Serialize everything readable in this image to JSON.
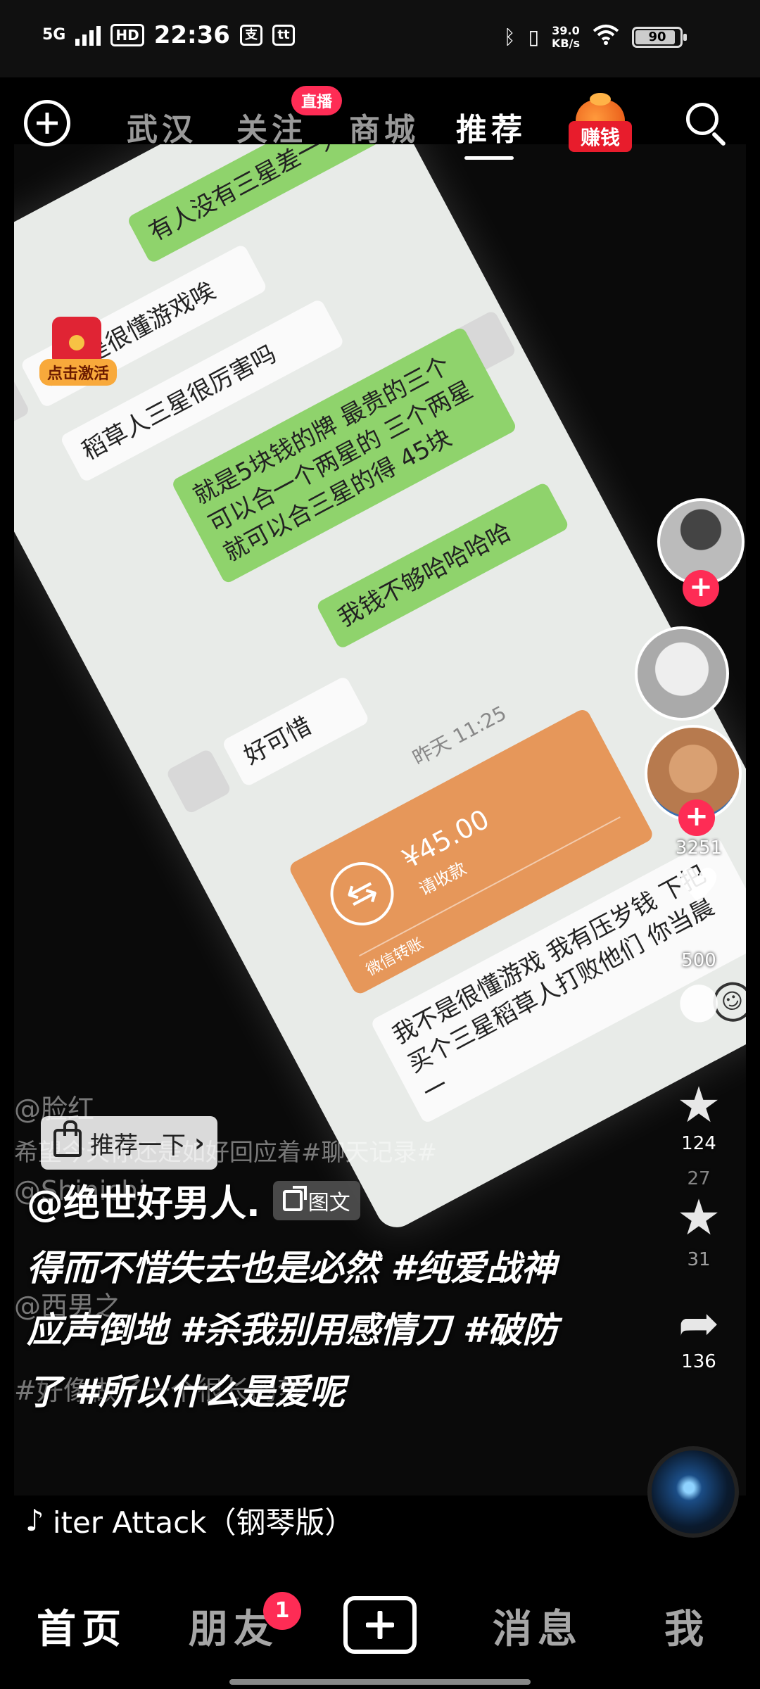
{
  "status_bar": {
    "network": "5G",
    "hd": "HD",
    "time": "22:36",
    "app_icon_1": "支",
    "app_icon_2": "tt",
    "speed_value": "39.0",
    "speed_unit": "KB/s",
    "battery": "90",
    "battery_level": 0.9
  },
  "top_nav": {
    "tabs": [
      "武汉",
      "关注",
      "商城",
      "推荐"
    ],
    "active_tab": "推荐",
    "live_badge": "直播",
    "earn_label": "赚钱"
  },
  "video": {
    "chat": {
      "b1": "有人没有三星差一只",
      "b2": "我不是很懂游戏唉",
      "b3": "稻草人三星很厉害吗",
      "b4": "就是5块钱的牌 最贵的三个可以合一个两星的 三个两星就可以合三星的得 45块",
      "b5": "我钱不够哈哈哈哈",
      "b6": "好可惜",
      "timestamp": "昨天 11:25",
      "transfer_amount": "¥45.00",
      "transfer_sub": "请收款",
      "transfer_note": "微信转账",
      "b7": "我不是很懂游戏 我有压岁钱 下把买个三星稻草人打败他们 你当晨一"
    },
    "ghost_lines": [
      "@脸红",
      "希望今天你还是如好回应着#聊天记录#",
      "@Shinichi",
      "@西男之",
      "#好像做了一个很长的梦"
    ]
  },
  "activate_widget": {
    "label": "点击激活"
  },
  "rail": {
    "likes": "3251",
    "comments": "500",
    "favorites": "124",
    "favorites_bg": "27",
    "shares_bg": "31",
    "shares": "136"
  },
  "recommend": {
    "label": "推荐一下"
  },
  "post": {
    "author": "@绝世好男人.",
    "type": "图文",
    "caption": "得而不惜失去也是必然 #纯爱战神应声倒地 #杀我别用感情刀 #破防了 #所以什么是爱呢"
  },
  "music": {
    "title": "iter Attack（钢琴版）"
  },
  "bottom_nav": {
    "items": [
      "首页",
      "朋友",
      "消息",
      "我"
    ],
    "active": "首页",
    "friends_badge": "1"
  },
  "icons": [
    "plus-icon",
    "search-icon",
    "earn-bag-icon",
    "heart-icon",
    "comment-icon",
    "star-icon",
    "share-icon",
    "music-note-icon",
    "thumb-up-icon",
    "doc-icon",
    "create-icon"
  ]
}
